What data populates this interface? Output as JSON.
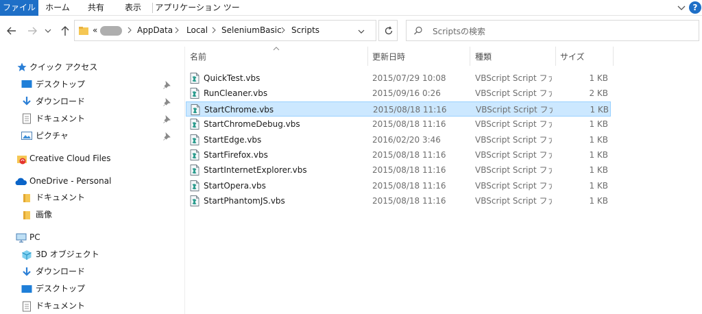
{
  "ribbon": {
    "tabs": [
      "ファイル",
      "ホーム",
      "共有",
      "表示",
      "アプリケーション ツール"
    ],
    "help": "?"
  },
  "address": {
    "overflow": "«",
    "crumbs": [
      "AppData",
      "Local",
      "SeleniumBasic",
      "Scripts"
    ]
  },
  "search": {
    "placeholder": "Scriptsの検索"
  },
  "nav": {
    "quick_access": "クイック アクセス",
    "quick_items": [
      "デスクトップ",
      "ダウンロード",
      "ドキュメント",
      "ピクチャ"
    ],
    "creative_cloud": "Creative Cloud Files",
    "onedrive": "OneDrive - Personal",
    "onedrive_items": [
      "ドキュメント",
      "画像"
    ],
    "pc": "PC",
    "pc_items": [
      "3D オブジェクト",
      "ダウンロード",
      "デスクトップ",
      "ドキュメント"
    ]
  },
  "columns": [
    "名前",
    "更新日時",
    "種類",
    "サイズ"
  ],
  "files": [
    {
      "name": "QuickTest.vbs",
      "date": "2015/07/29 10:08",
      "type": "VBScript Script ファ...",
      "size": "1 KB"
    },
    {
      "name": "RunCleaner.vbs",
      "date": "2015/09/16 0:26",
      "type": "VBScript Script ファ...",
      "size": "2 KB"
    },
    {
      "name": "StartChrome.vbs",
      "date": "2015/08/18 11:16",
      "type": "VBScript Script ファ...",
      "size": "1 KB"
    },
    {
      "name": "StartChromeDebug.vbs",
      "date": "2015/08/18 11:16",
      "type": "VBScript Script ファ...",
      "size": "1 KB"
    },
    {
      "name": "StartEdge.vbs",
      "date": "2016/02/20 3:46",
      "type": "VBScript Script ファ...",
      "size": "1 KB"
    },
    {
      "name": "StartFirefox.vbs",
      "date": "2015/08/18 11:16",
      "type": "VBScript Script ファ...",
      "size": "1 KB"
    },
    {
      "name": "StartInternetExplorer.vbs",
      "date": "2015/08/18 11:16",
      "type": "VBScript Script ファ...",
      "size": "1 KB"
    },
    {
      "name": "StartOpera.vbs",
      "date": "2015/08/18 11:16",
      "type": "VBScript Script ファ...",
      "size": "1 KB"
    },
    {
      "name": "StartPhantomJS.vbs",
      "date": "2015/08/18 11:16",
      "type": "VBScript Script ファ...",
      "size": "1 KB"
    }
  ],
  "selected_file": "StartChrome.vbs",
  "colors": {
    "accent": "#1e6fc7",
    "selection": "#cce8ff",
    "selection_border": "#99d1ff"
  }
}
